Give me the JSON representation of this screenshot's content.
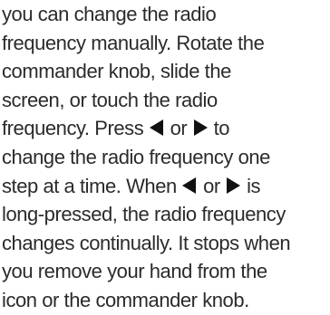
{
  "paragraph": {
    "line1": "you can change the radio",
    "line2": "frequency manually. Rotate the",
    "line3": "commander knob, slide the",
    "line4": "screen, or touch the radio",
    "line5": {
      "before": "frequency. Press ",
      "middle": " or ",
      "after": " to"
    },
    "line6": "change the radio frequency one",
    "line7": {
      "before": "step at a time. When ",
      "middle": " or ",
      "after": " is"
    },
    "line8": "long-pressed, the radio frequency",
    "line9": "changes continually. It stops when",
    "line10": "you remove your hand from the",
    "line11": "icon or the commander knob."
  },
  "icons": {
    "left": "left-triangle-icon",
    "right": "right-triangle-icon"
  },
  "colors": {
    "text": "#2b2b2b",
    "icon": "#111111"
  }
}
